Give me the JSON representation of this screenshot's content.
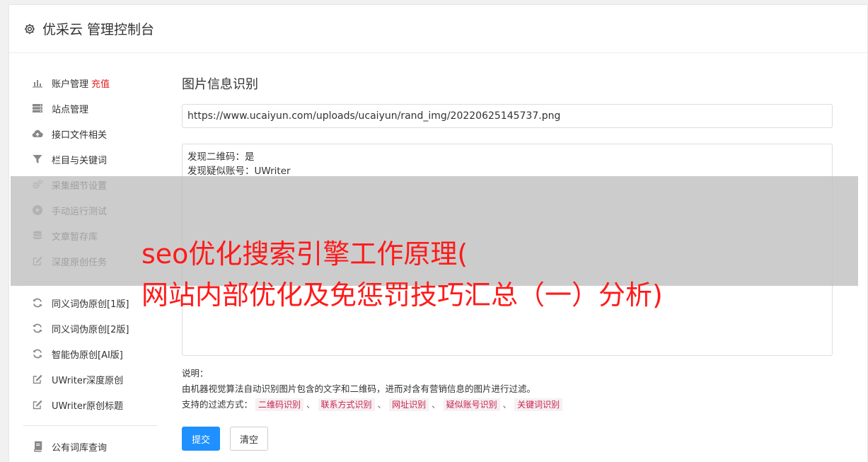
{
  "header": {
    "title": "优采云 管理控制台"
  },
  "sidebar": {
    "groups": [
      [
        {
          "label": "账户管理",
          "extra": "充值",
          "icon": "bar-chart-icon"
        },
        {
          "label": "站点管理",
          "icon": "server-icon"
        },
        {
          "label": "接口文件相关",
          "icon": "cloud-upload-icon"
        },
        {
          "label": "栏目与关键词",
          "icon": "filter-icon"
        },
        {
          "label": "采集细节设置",
          "icon": "cogs-icon"
        },
        {
          "label": "手动运行测试",
          "icon": "play-circle-icon"
        },
        {
          "label": "文章暂存库",
          "icon": "database-icon"
        },
        {
          "label": "深度原创任务",
          "icon": "edit-icon"
        }
      ],
      [
        {
          "label": "同义词伪原创[1版]",
          "icon": "refresh-icon"
        },
        {
          "label": "同义词伪原创[2版]",
          "icon": "refresh-icon"
        },
        {
          "label": "智能伪原创[AI版]",
          "icon": "refresh-icon"
        },
        {
          "label": "UWriter深度原创",
          "icon": "edit-icon"
        },
        {
          "label": "UWriter原创标题",
          "icon": "edit-icon"
        }
      ],
      [
        {
          "label": "公有词库查询",
          "icon": "book-icon"
        }
      ]
    ]
  },
  "main": {
    "title": "图片信息识别",
    "url_value": "https://www.ucaiyun.com/uploads/ucaiyun/rand_img/20220625145737.png",
    "result_lines": [
      "发现二维码：是",
      "发现疑似账号：UWriter"
    ],
    "desc_label": "说明：",
    "desc_text": "由机器视觉算法自动识别图片包含的文字和二维码，进而对含有营销信息的图片进行过滤。",
    "filter_label": "支持的过滤方式：",
    "filters": [
      "二维码识别",
      "联系方式识别",
      "网址识别",
      "疑似账号识别",
      "关键词识别"
    ],
    "filter_separator": "、",
    "submit_label": "提交",
    "clear_label": "清空"
  },
  "overlay": {
    "line1": "seo优化搜索引擎工作原理(",
    "line2": "网站内部优化及免惩罚技巧汇总（一）分析)",
    "text_color": "#ff1a1a"
  }
}
